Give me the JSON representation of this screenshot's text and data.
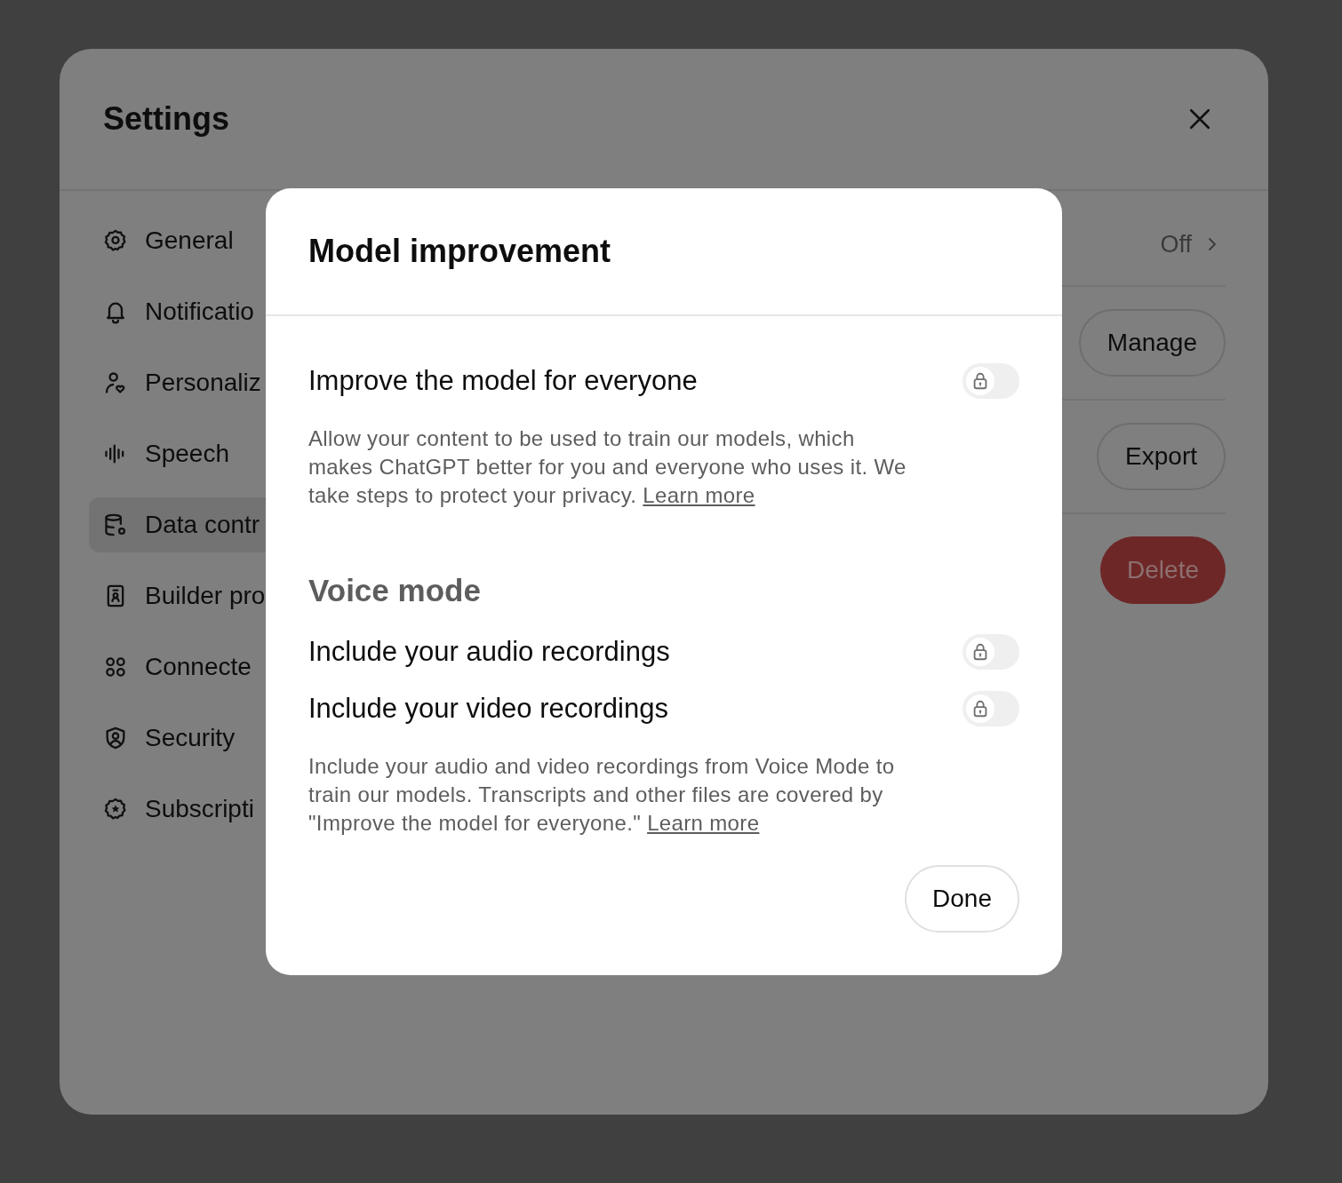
{
  "settings": {
    "title": "Settings",
    "sidebar": {
      "items": [
        {
          "label": "General",
          "selected": false
        },
        {
          "label": "Notificatio",
          "selected": false
        },
        {
          "label": "Personaliz",
          "selected": false
        },
        {
          "label": "Speech",
          "selected": false
        },
        {
          "label": "Data contr",
          "selected": true
        },
        {
          "label": "Builder pro",
          "selected": false
        },
        {
          "label": "Connecte",
          "selected": false
        },
        {
          "label": "Security",
          "selected": false
        },
        {
          "label": "Subscripti",
          "selected": false
        }
      ]
    },
    "rows": [
      {
        "kind": "value",
        "value": "Off"
      },
      {
        "kind": "button",
        "label": "Manage"
      },
      {
        "kind": "button",
        "label": "Export"
      },
      {
        "kind": "danger",
        "label": "Delete"
      }
    ]
  },
  "dialog": {
    "title": "Model improvement",
    "sections": [
      {
        "kind": "toggle",
        "label": "Improve the model for everyone",
        "on": false
      },
      {
        "kind": "description",
        "text": "Allow your content to be used to train our models, which makes ChatGPT better for you and everyone who uses it. We take steps to protect your privacy.",
        "link": "Learn more"
      },
      {
        "kind": "heading",
        "text": "Voice mode"
      },
      {
        "kind": "toggle",
        "label": "Include your audio recordings",
        "on": false
      },
      {
        "kind": "toggle",
        "label": "Include your video recordings",
        "on": false
      },
      {
        "kind": "description",
        "text": "Include your audio and video recordings from Voice Mode to train our models. Transcripts and other files are covered by \"Improve the model for everyone.\"",
        "link": "Learn more"
      }
    ],
    "button": "Done"
  }
}
